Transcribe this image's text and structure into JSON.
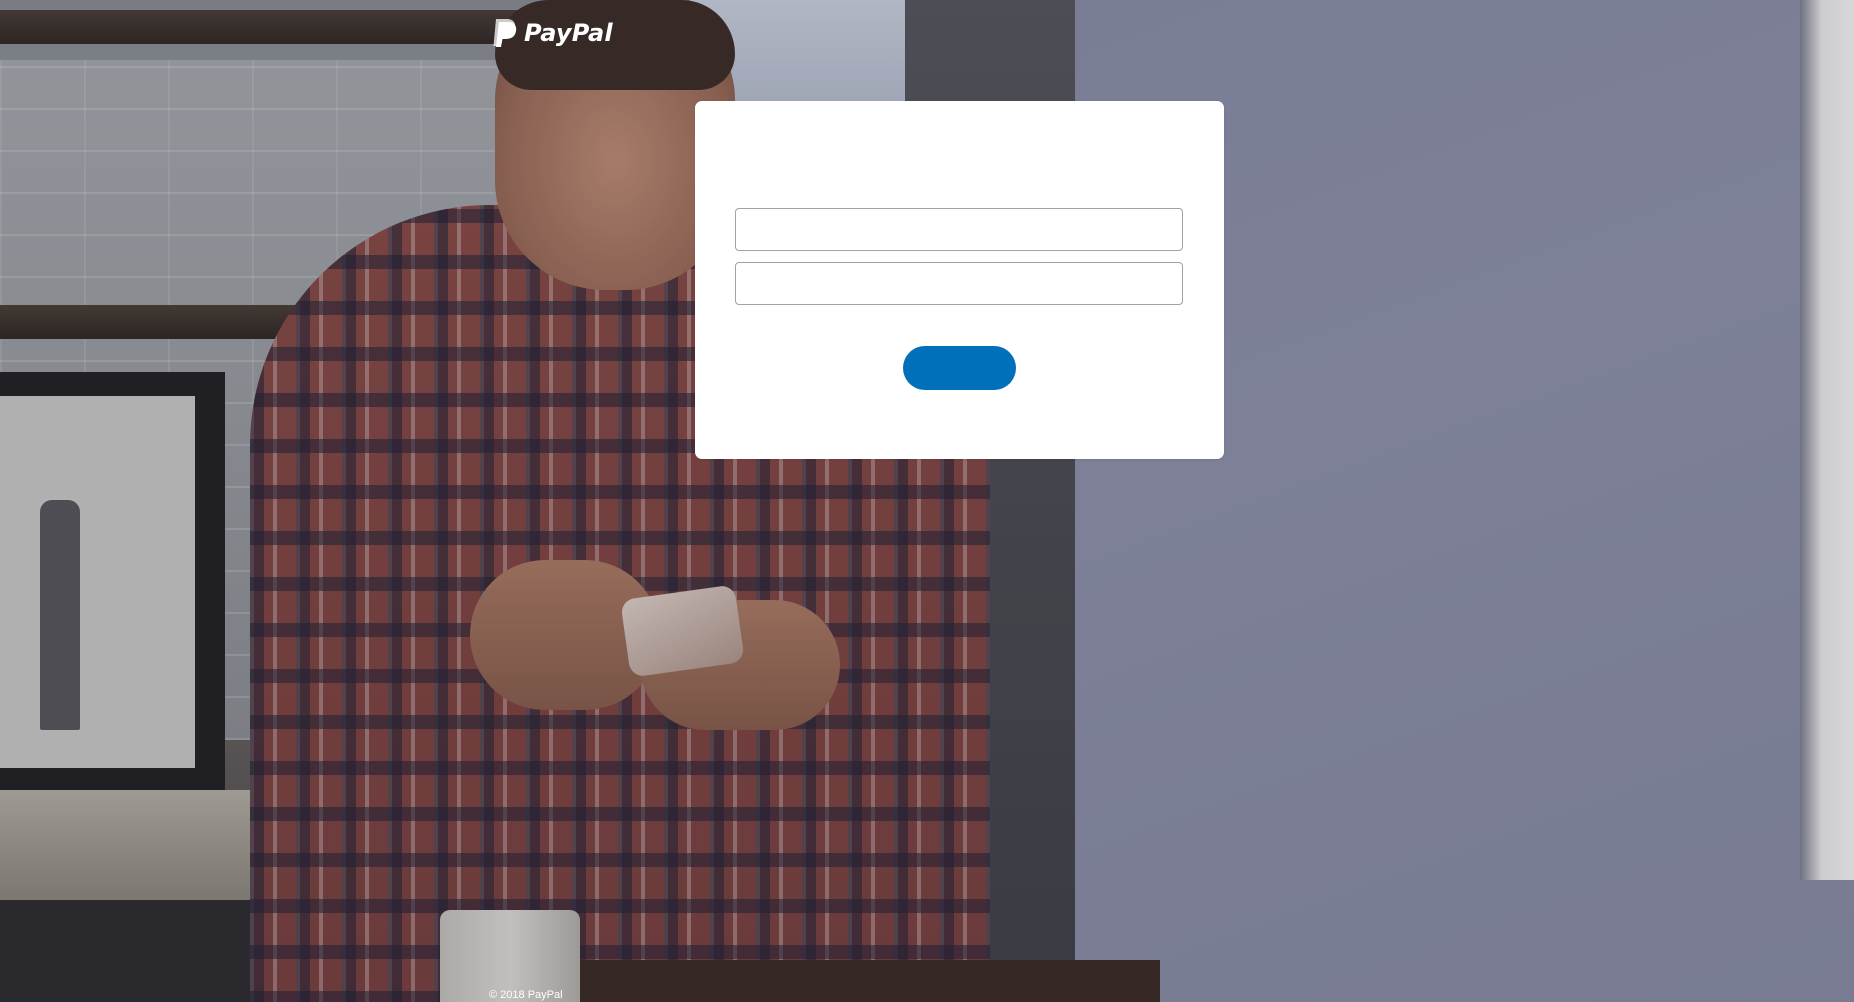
{
  "header": {
    "logo_text": "PayPal",
    "logo_icon": "paypal-p-icon"
  },
  "login": {
    "email": {
      "value": "",
      "placeholder": ""
    },
    "password": {
      "value": "",
      "placeholder": ""
    },
    "button_label": ""
  },
  "footer": {
    "copyright": "© 2018 PayPal"
  },
  "colors": {
    "button": "#0070ba",
    "card": "#ffffff",
    "field_border": "#9da3a6",
    "logo": "#ffffff"
  }
}
